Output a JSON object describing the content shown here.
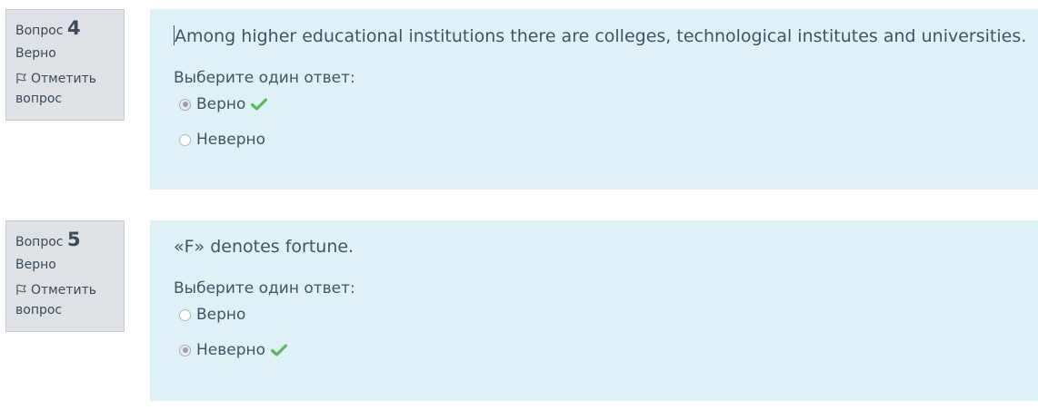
{
  "questions": [
    {
      "label": "Вопрос",
      "number": "4",
      "state": "Верно",
      "flag_label": "Отметить вопрос",
      "text": "Among higher educational institutions there are colleges, technological institutes and universities.",
      "prompt": "Выберите один ответ:",
      "options": [
        {
          "label": "Верно",
          "selected": true,
          "correct": true
        },
        {
          "label": "Неверно",
          "selected": false,
          "correct": false
        }
      ]
    },
    {
      "label": "Вопрос",
      "number": "5",
      "state": "Верно",
      "flag_label": "Отметить вопрос",
      "text": "«F» denotes fortune.",
      "prompt": "Выберите один ответ:",
      "options": [
        {
          "label": "Верно",
          "selected": false,
          "correct": false
        },
        {
          "label": "Неверно",
          "selected": true,
          "correct": true
        }
      ]
    }
  ],
  "colors": {
    "info_bg": "#dee2e6",
    "content_bg": "#def1f7",
    "text": "#3d5566",
    "correct_check": "#5cb85c"
  },
  "icons": {
    "flag": "flag-icon",
    "correct": "checkmark-icon"
  }
}
